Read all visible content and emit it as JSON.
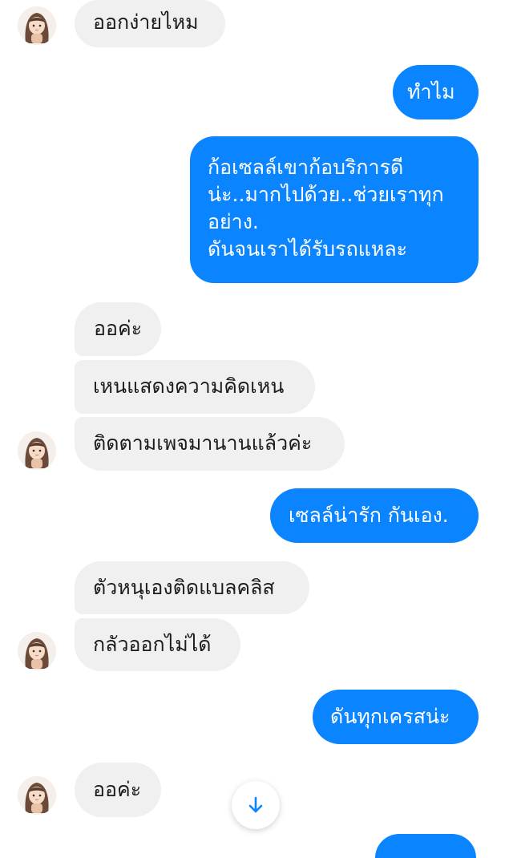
{
  "messages": [
    {
      "id": "m1",
      "side": "in",
      "text": "ออกง่ายไหม"
    },
    {
      "id": "m2",
      "side": "out",
      "text": "ทำไม"
    },
    {
      "id": "m3",
      "side": "out",
      "text": "ก้อเซลล์เขาก้อบริการดี\nน่ะ..มากไปด้วย..ช่วยเราทุก\nอย่าง.\nดันจนเราได้รับรถแหละ"
    },
    {
      "id": "m4",
      "side": "in",
      "text": "ออค่ะ"
    },
    {
      "id": "m5",
      "side": "in",
      "text": "เหนแสดงความคิดเหน"
    },
    {
      "id": "m6",
      "side": "in",
      "text": "ติดตามเพจมานานแล้วค่ะ"
    },
    {
      "id": "m7",
      "side": "out",
      "text": "เซลล์น่ารัก กันเอง."
    },
    {
      "id": "m8",
      "side": "in",
      "text": "ตัวหนุเองติดแบลคลิส"
    },
    {
      "id": "m9",
      "side": "in",
      "text": "กลัวออกไม่ได้"
    },
    {
      "id": "m10",
      "side": "out",
      "text": "ดันทุกเครสน่ะ"
    },
    {
      "id": "m11",
      "side": "in",
      "text": "ออค่ะ"
    }
  ],
  "scroll_button": {
    "icon": "arrow-down-icon"
  },
  "colors": {
    "outgoing": "#0a84ff",
    "incoming": "#f0f0f0",
    "accent": "#0a84ff"
  }
}
